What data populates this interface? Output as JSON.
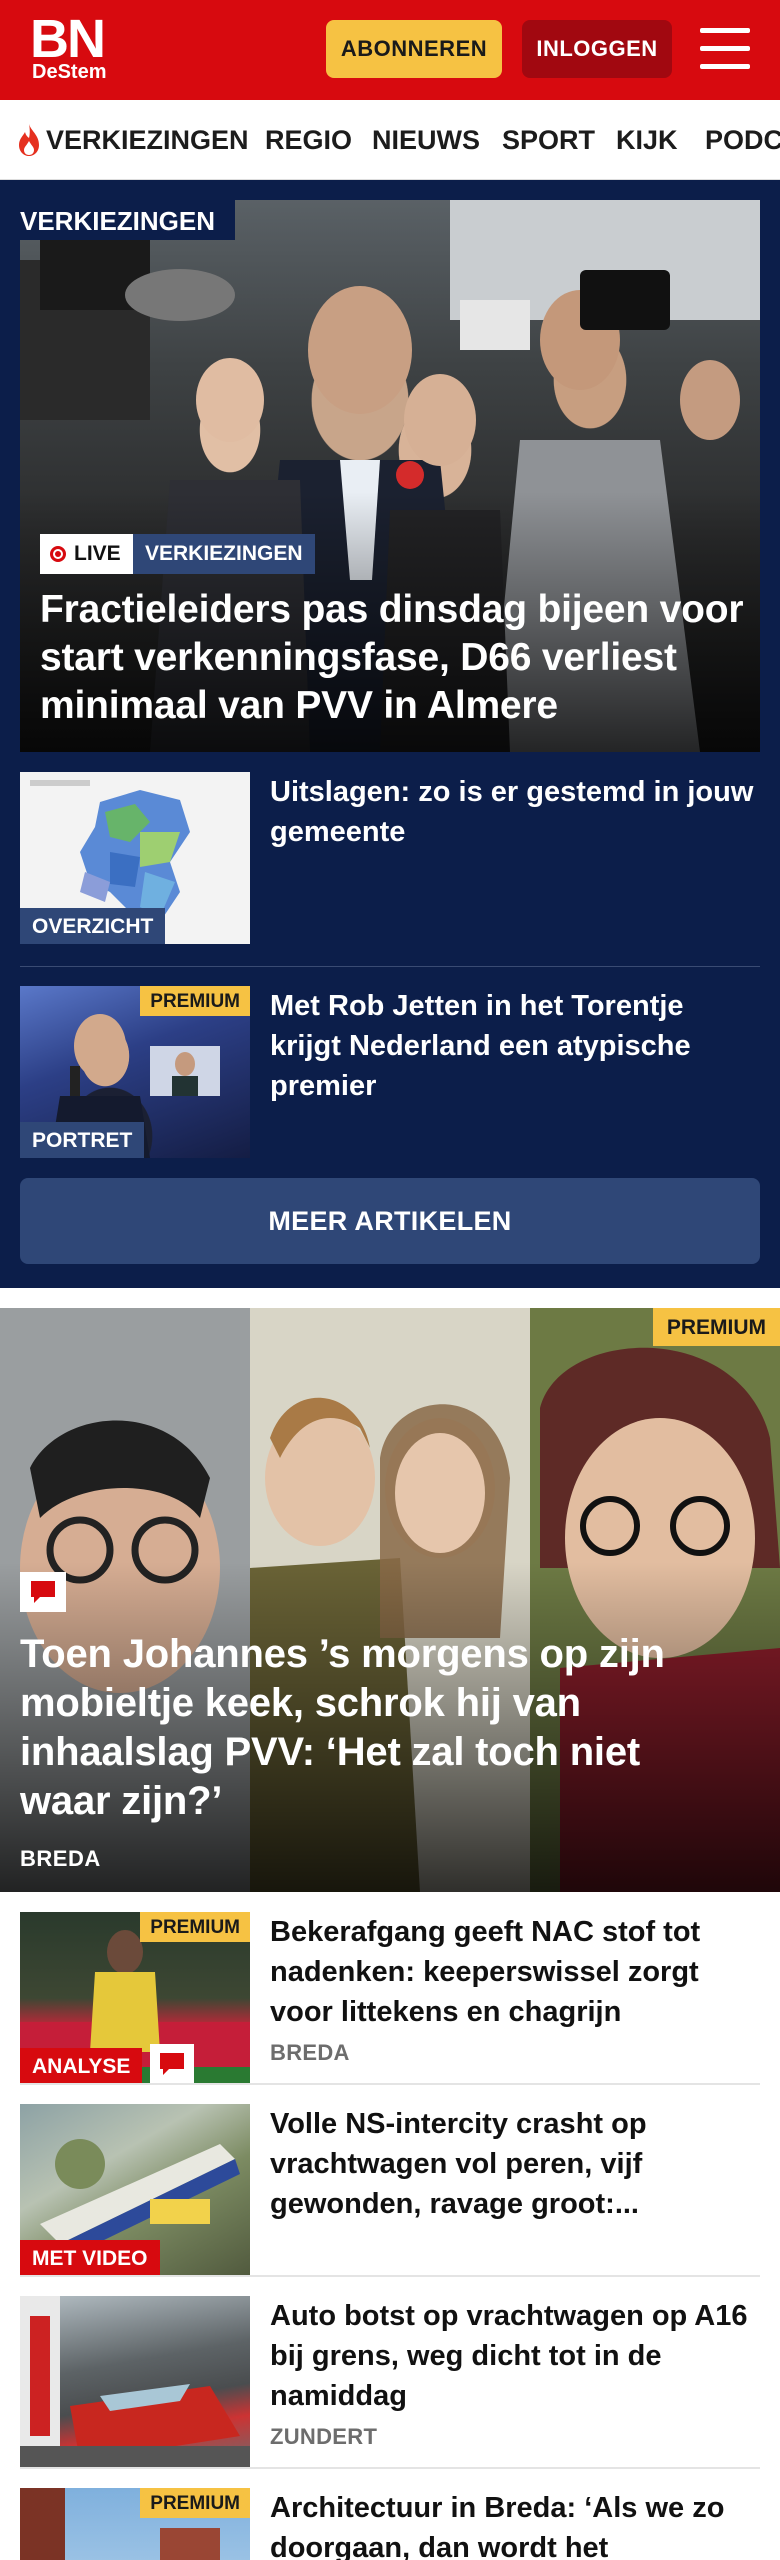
{
  "header": {
    "logo_main": "BN",
    "logo_sub": "DeStem",
    "subscribe_label": "ABONNEREN",
    "login_label": "INLOGGEN",
    "brand_color": "#d70a0f",
    "subscribe_color": "#f6c243"
  },
  "nav": {
    "items": [
      "VERKIEZINGEN",
      "REGIO",
      "NIEUWS",
      "SPORT",
      "KIJK",
      "PODC"
    ]
  },
  "election": {
    "section_tag": "VERKIEZINGEN",
    "bg_color": "#0c1e4a",
    "hero": {
      "live_label": "LIVE",
      "category": "VERKIEZINGEN",
      "title": "Fractieleiders pas dinsdag bijeen voor start verkenningsfase, D66 verliest minimaal van PVV in Almere"
    },
    "side_articles": [
      {
        "label": "OVERZICHT",
        "title": "Uitslagen: zo is er gestemd in jouw gemeente",
        "premium": ""
      },
      {
        "label": "PORTRET",
        "title": "Met Rob Jetten in het Torentje krijgt Nederland een atypische premier",
        "premium": "PREMIUM"
      }
    ],
    "more_label": "MEER ARTIKELEN"
  },
  "feature": {
    "premium": "PREMIUM",
    "title": "Toen Johannes ’s morgens op zijn mobieltje keek, schrok hij van inhaalslag PVV: ‘Het zal toch niet waar zijn?’",
    "location": "BREDA"
  },
  "articles": [
    {
      "premium": "PREMIUM",
      "tag": "ANALYSE",
      "title": "Bekerafgang geeft NAC stof tot nadenken: keeperswissel zorgt voor littekens en chagrijn",
      "location": "BREDA",
      "comments": true
    },
    {
      "premium": "",
      "tag": "MET VIDEO",
      "title": "Volle NS-intercity crasht op vrachtwagen vol peren, vijf gewonden, ravage groot:...",
      "location": "",
      "comments": false
    },
    {
      "premium": "",
      "tag": "",
      "title": "Auto botst op vrachtwagen op A16 bij grens, weg dicht tot in de namiddag",
      "location": "ZUNDERT",
      "comments": false
    },
    {
      "premium": "PREMIUM",
      "tag": "",
      "title": "Architectuur in Breda: ‘Als we zo doorgaan, dan wordt het",
      "location": "",
      "comments": false
    }
  ]
}
